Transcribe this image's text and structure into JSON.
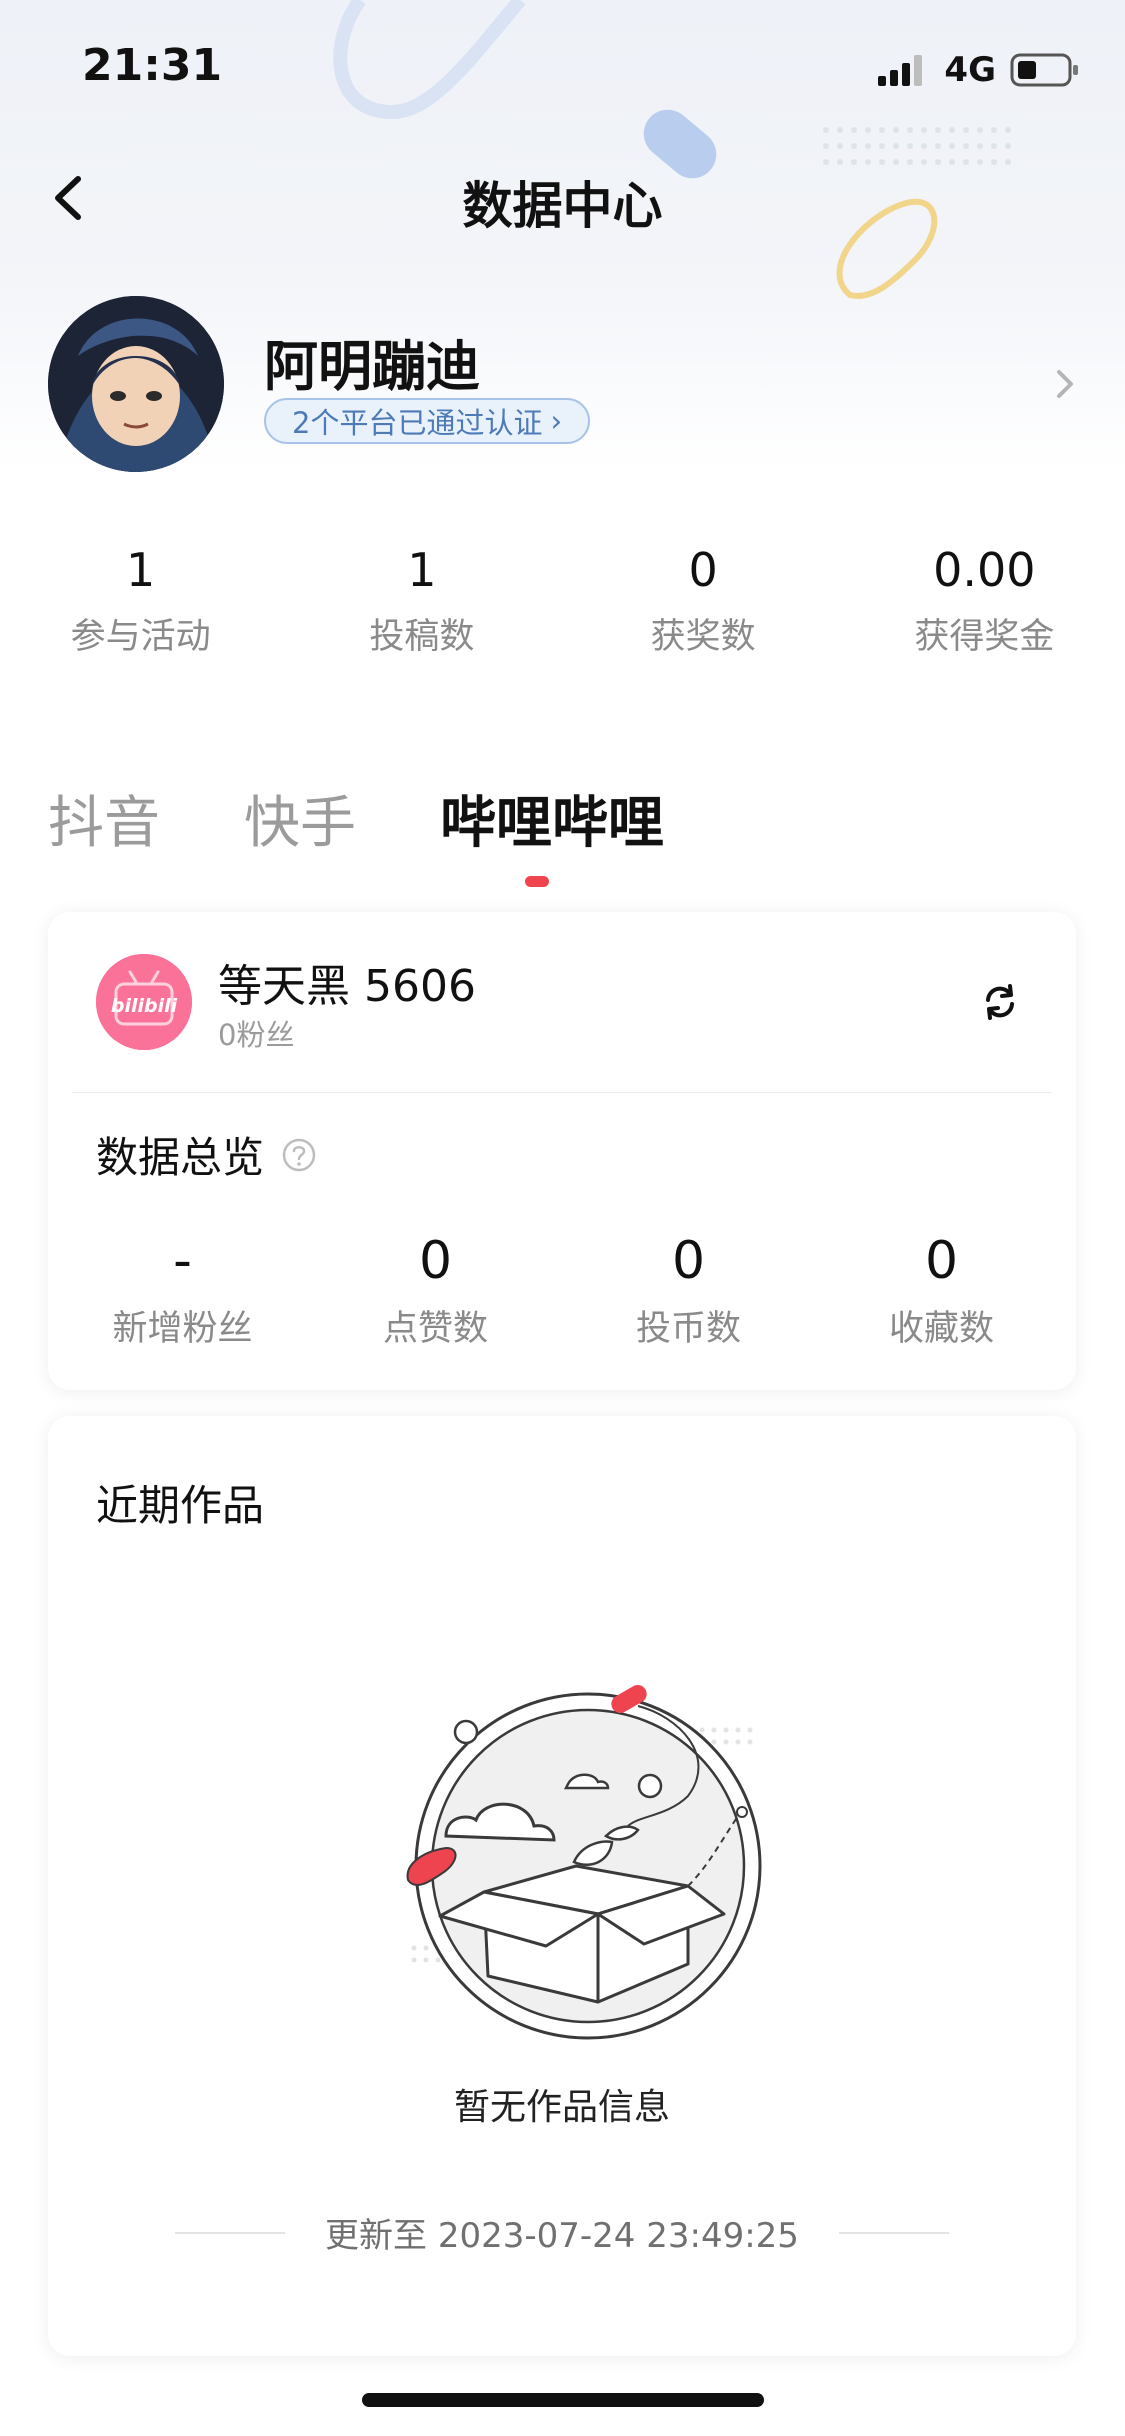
{
  "status_bar": {
    "time": "21:31",
    "network": "4G"
  },
  "header": {
    "title": "数据中心"
  },
  "profile": {
    "name": "阿明蹦迪",
    "verify_text": "2个平台已通过认证",
    "verify_chevron": "›"
  },
  "stats": [
    {
      "value": "1",
      "label": "参与活动"
    },
    {
      "value": "1",
      "label": "投稿数"
    },
    {
      "value": "0",
      "label": "获奖数"
    },
    {
      "value": "0.00",
      "label": "获得奖金"
    }
  ],
  "tabs": [
    {
      "label": "抖音",
      "active": false
    },
    {
      "label": "快手",
      "active": false
    },
    {
      "label": "哔哩哔哩",
      "active": true
    }
  ],
  "account": {
    "name": "等天黑 5606",
    "fans": "0粉丝",
    "logo_text": "bilibili"
  },
  "overview": {
    "title": "数据总览",
    "metrics": [
      {
        "value": "-",
        "label": "新增粉丝"
      },
      {
        "value": "0",
        "label": "点赞数"
      },
      {
        "value": "0",
        "label": "投币数"
      },
      {
        "value": "0",
        "label": "收藏数"
      }
    ]
  },
  "works": {
    "title": "近期作品",
    "empty_text": "暂无作品信息",
    "update_text": "更新至 2023-07-24 23:49:25"
  },
  "colors": {
    "accent": "#f0454f",
    "bilibili_pink": "#fb7299",
    "verify_blue": "#4d7bb8"
  }
}
